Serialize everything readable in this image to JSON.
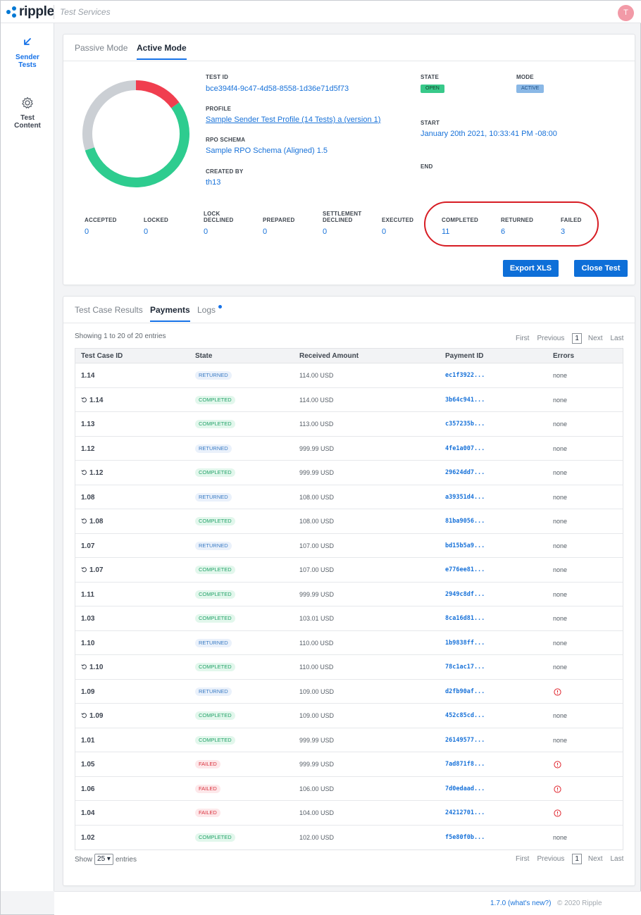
{
  "header": {
    "logo_text": "ripple",
    "app_name": "Test Services",
    "avatar_initial": "T"
  },
  "sidebar": {
    "items": [
      {
        "label_line1": "Sender",
        "label_line2": "Tests",
        "icon": "arrow-down-left-icon",
        "active": true
      },
      {
        "label_line1": "Test",
        "label_line2": "Content",
        "icon": "gear-icon",
        "active": false
      }
    ]
  },
  "summary": {
    "tabs": [
      {
        "label": "Passive Mode"
      },
      {
        "label": "Active Mode"
      }
    ],
    "donut": {
      "failed": 3,
      "completed": 11,
      "other": 6,
      "colors": {
        "failed": "#f03e4f",
        "completed": "#2ecc8f",
        "other": "#cbcfd4"
      }
    },
    "fields": {
      "test_id_label": "TEST ID",
      "test_id": "bce394f4-9c47-4d58-8558-1d36e71d5f73",
      "profile_label": "PROFILE",
      "profile": "Sample Sender Test Profile (14 Tests) a (version 1)",
      "rpo_label": "RPO SCHEMA",
      "rpo": "Sample RPO Schema (Aligned) 1.5",
      "created_by_label": "CREATED BY",
      "created_by": "th13",
      "state_label": "STATE",
      "state": "OPEN",
      "mode_label": "MODE",
      "mode": "ACTIVE",
      "start_label": "START",
      "start": "January 20th 2021, 10:33:41 PM -08:00",
      "end_label": "END"
    },
    "stats": [
      {
        "label1": "ACCEPTED",
        "label2": "",
        "value": "0"
      },
      {
        "label1": "LOCKED",
        "label2": "",
        "value": "0"
      },
      {
        "label1": "LOCK",
        "label2": "DECLINED",
        "value": "0"
      },
      {
        "label1": "PREPARED",
        "label2": "",
        "value": "0"
      },
      {
        "label1": "SETTLEMENT",
        "label2": "DECLINED",
        "value": "0"
      },
      {
        "label1": "EXECUTED",
        "label2": "",
        "value": "0"
      },
      {
        "label1": "COMPLETED",
        "label2": "",
        "value": "11"
      },
      {
        "label1": "RETURNED",
        "label2": "",
        "value": "6"
      },
      {
        "label1": "FAILED",
        "label2": "",
        "value": "3"
      }
    ],
    "export_label": "Export XLS",
    "close_label": "Close Test"
  },
  "results": {
    "tabs": [
      {
        "label": "Test Case Results"
      },
      {
        "label": "Payments"
      },
      {
        "label": "Logs"
      }
    ],
    "showing": "Showing 1 to 20 of 20 entries",
    "pager": {
      "first": "First",
      "previous": "Previous",
      "page": "1",
      "next": "Next",
      "last": "Last"
    },
    "columns": [
      "Test Case ID",
      "State",
      "Received Amount",
      "Payment ID",
      "Errors"
    ],
    "rows": [
      {
        "id": "1.14",
        "retry": false,
        "state": "RETURNED",
        "amount": "114.00 USD",
        "pid": "ec1f3922...",
        "errors": "none"
      },
      {
        "id": "1.14",
        "retry": true,
        "state": "COMPLETED",
        "amount": "114.00 USD",
        "pid": "3b64c941...",
        "errors": "none"
      },
      {
        "id": "1.13",
        "retry": false,
        "state": "COMPLETED",
        "amount": "113.00 USD",
        "pid": "c357235b...",
        "errors": "none"
      },
      {
        "id": "1.12",
        "retry": false,
        "state": "RETURNED",
        "amount": "999.99 USD",
        "pid": "4fe1a007...",
        "errors": "none"
      },
      {
        "id": "1.12",
        "retry": true,
        "state": "COMPLETED",
        "amount": "999.99 USD",
        "pid": "29624dd7...",
        "errors": "none"
      },
      {
        "id": "1.08",
        "retry": false,
        "state": "RETURNED",
        "amount": "108.00 USD",
        "pid": "a39351d4...",
        "errors": "none"
      },
      {
        "id": "1.08",
        "retry": true,
        "state": "COMPLETED",
        "amount": "108.00 USD",
        "pid": "81ba9056...",
        "errors": "none"
      },
      {
        "id": "1.07",
        "retry": false,
        "state": "RETURNED",
        "amount": "107.00 USD",
        "pid": "bd15b5a9...",
        "errors": "none"
      },
      {
        "id": "1.07",
        "retry": true,
        "state": "COMPLETED",
        "amount": "107.00 USD",
        "pid": "e776ee81...",
        "errors": "none"
      },
      {
        "id": "1.11",
        "retry": false,
        "state": "COMPLETED",
        "amount": "999.99 USD",
        "pid": "2949c8df...",
        "errors": "none"
      },
      {
        "id": "1.03",
        "retry": false,
        "state": "COMPLETED",
        "amount": "103.01 USD",
        "pid": "8ca16d81...",
        "errors": "none"
      },
      {
        "id": "1.10",
        "retry": false,
        "state": "RETURNED",
        "amount": "110.00 USD",
        "pid": "1b9838ff...",
        "errors": "none"
      },
      {
        "id": "1.10",
        "retry": true,
        "state": "COMPLETED",
        "amount": "110.00 USD",
        "pid": "78c1ac17...",
        "errors": "none"
      },
      {
        "id": "1.09",
        "retry": false,
        "state": "RETURNED",
        "amount": "109.00 USD",
        "pid": "d2fb90af...",
        "errors": ""
      },
      {
        "id": "1.09",
        "retry": true,
        "state": "COMPLETED",
        "amount": "109.00 USD",
        "pid": "452c85cd...",
        "errors": "none"
      },
      {
        "id": "1.01",
        "retry": false,
        "state": "COMPLETED",
        "amount": "999.99 USD",
        "pid": "26149577...",
        "errors": "none"
      },
      {
        "id": "1.05",
        "retry": false,
        "state": "FAILED",
        "amount": "999.99 USD",
        "pid": "7ad871f8...",
        "errors": ""
      },
      {
        "id": "1.06",
        "retry": false,
        "state": "FAILED",
        "amount": "106.00 USD",
        "pid": "7d0edaad...",
        "errors": ""
      },
      {
        "id": "1.04",
        "retry": false,
        "state": "FAILED",
        "amount": "104.00 USD",
        "pid": "24212701...",
        "errors": ""
      },
      {
        "id": "1.02",
        "retry": false,
        "state": "COMPLETED",
        "amount": "102.00 USD",
        "pid": "f5e80f0b...",
        "errors": "none"
      }
    ],
    "show_prefix": "Show",
    "page_size": "25",
    "show_suffix": "entries"
  },
  "footer": {
    "version": "1.7.0 (what's new?)",
    "copyright": "© 2020 Ripple"
  },
  "colors": {
    "accent": "#1672e8",
    "annotation": "#d71d24"
  }
}
